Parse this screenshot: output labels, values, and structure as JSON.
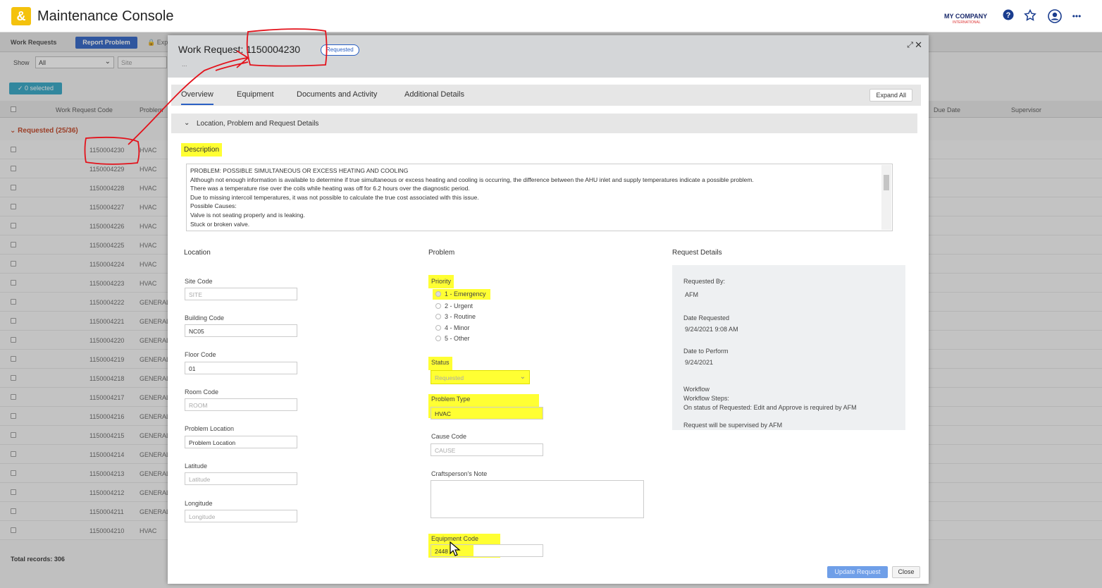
{
  "app": {
    "title": "Maintenance Console",
    "company_name": "MY COMPANY",
    "company_sub": "INTERNATIONAL",
    "brand_color": "#f4c20d"
  },
  "header_icons": [
    "help-icon",
    "favorites-star-icon",
    "user-avatar-icon",
    "more-icon"
  ],
  "toolbar": {
    "tab_label": "Work Requests",
    "report_button": "Report Problem",
    "export_partial": "Exp",
    "show_label": "Show",
    "show_value": "All",
    "site_placeholder": "Site",
    "selected_button": "✓ 0 selected"
  },
  "list": {
    "headers": {
      "code": "Work Request Code",
      "problem": "Problem",
      "due_date": "Due Date",
      "supervisor": "Supervisor"
    },
    "group_label": "Requested (25/36)",
    "rows": [
      {
        "code": "1150004230",
        "problem": "HVAC"
      },
      {
        "code": "1150004229",
        "problem": "HVAC"
      },
      {
        "code": "1150004228",
        "problem": "HVAC"
      },
      {
        "code": "1150004227",
        "problem": "HVAC"
      },
      {
        "code": "1150004226",
        "problem": "HVAC"
      },
      {
        "code": "1150004225",
        "problem": "HVAC"
      },
      {
        "code": "1150004224",
        "problem": "HVAC"
      },
      {
        "code": "1150004223",
        "problem": "HVAC"
      },
      {
        "code": "1150004222",
        "problem": "GENERAL"
      },
      {
        "code": "1150004221",
        "problem": "GENERAL"
      },
      {
        "code": "1150004220",
        "problem": "GENERAL"
      },
      {
        "code": "1150004219",
        "problem": "GENERAL"
      },
      {
        "code": "1150004218",
        "problem": "GENERAL"
      },
      {
        "code": "1150004217",
        "problem": "GENERAL"
      },
      {
        "code": "1150004216",
        "problem": "GENERAL"
      },
      {
        "code": "1150004215",
        "problem": "GENERAL"
      },
      {
        "code": "1150004214",
        "problem": "GENERAL"
      },
      {
        "code": "1150004213",
        "problem": "GENERAL"
      },
      {
        "code": "1150004212",
        "problem": "GENERAL"
      },
      {
        "code": "1150004211",
        "problem": "GENERAL"
      },
      {
        "code": "1150004210",
        "problem": "HVAC"
      }
    ],
    "total_records": "Total records: 306"
  },
  "modal": {
    "title": "Work Request: 1150004230",
    "badge": "Requested",
    "subtitle": "...",
    "tabs": [
      "Overview",
      "Equipment",
      "Documents and Activity",
      "Additional Details"
    ],
    "expand_all": "Expand All",
    "section_title": "Location, Problem and Request Details",
    "description_label": "Description",
    "description_lines": [
      "PROBLEM: POSSIBLE SIMULTANEOUS OR EXCESS HEATING AND COOLING",
      "Although not enough information is available to determine if true simultaneous or excess heating and cooling is occurring, the difference between the AHU inlet and supply temperatures indicate a possible problem.",
      "There was a temperature rise over the coils while heating was off for 6.2 hours over the diagnostic period.",
      "Due to missing intercoil temperatures, it was not possible to calculate the true cost associated with this issue.",
      "Possible Causes:",
      "Valve is not seating properly and is leaking.",
      "Stuck or broken valve."
    ],
    "location": {
      "title": "Location",
      "site_code_label": "Site Code",
      "site_code_placeholder": "SITE",
      "building_code_label": "Building Code",
      "building_code_value": "NC05",
      "floor_code_label": "Floor Code",
      "floor_code_value": "01",
      "room_code_label": "Room Code",
      "room_code_placeholder": "ROOM",
      "problem_location_label": "Problem Location",
      "problem_location_placeholder": "Problem Location",
      "latitude_label": "Latitude",
      "latitude_placeholder": "Latitude",
      "longitude_label": "Longitude",
      "longitude_placeholder": "Longitude"
    },
    "problem": {
      "title": "Problem",
      "priority_label": "Priority",
      "priority_options": [
        "1 - Emergency",
        "2 - Urgent",
        "3 - Routine",
        "4 - Minor",
        "5 - Other"
      ],
      "status_label": "Status",
      "status_value": "Requested",
      "problem_type_label": "Problem Type",
      "problem_type_value": "HVAC",
      "cause_code_label": "Cause Code",
      "cause_code_placeholder": "CAUSE",
      "crafts_note_label": "Craftsperson's Note",
      "equipment_code_label": "Equipment Code",
      "equipment_code_value": "2448"
    },
    "request_details": {
      "title": "Request Details",
      "requested_by_label": "Requested By:",
      "requested_by_value": "AFM",
      "date_requested_label": "Date Requested",
      "date_requested_value": "9/24/2021  9:08 AM",
      "date_to_perform_label": "Date to Perform",
      "date_to_perform_value": "9/24/2021",
      "workflow_label": "Workflow",
      "workflow_steps": "Workflow Steps:",
      "workflow_line1": "On status of Requested: Edit and Approve is required by AFM",
      "workflow_line2": "Request will be supervised by AFM"
    },
    "buttons": {
      "update": "Update Request",
      "close": "Close"
    }
  },
  "colors": {
    "primary_blue": "#2a60c4",
    "highlight": "#ffff33",
    "annotation_red": "#e3121b"
  }
}
